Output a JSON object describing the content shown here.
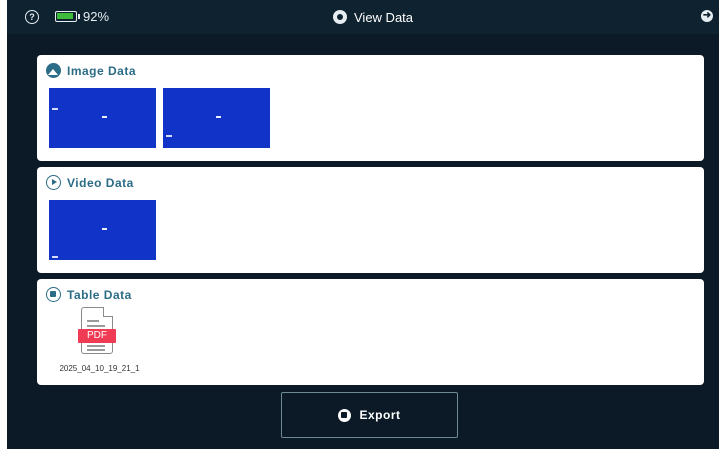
{
  "header": {
    "help_icon": "?",
    "battery_level": 0.92,
    "battery_text": "92%",
    "title": "View Data",
    "exit_icon": "➜"
  },
  "sections": {
    "image": {
      "title": "Image Data",
      "icon": "image-icon",
      "thumbnails": [
        "image-thumbnail-1",
        "image-thumbnail-2"
      ]
    },
    "video": {
      "title": "Video Data",
      "icon": "play-icon",
      "thumbnails": [
        "video-thumbnail-1"
      ]
    },
    "table": {
      "title": "Table Data",
      "icon": "table-icon",
      "file_badge": "PDF",
      "file_name": "2025_04_10_19_21_1"
    }
  },
  "footer": {
    "export_label": "Export",
    "export_icon": "export-icon"
  },
  "colors": {
    "background": "#0b1a26",
    "accent": "#2b6c86",
    "thumbnail": "#1133c8",
    "pdf_badge": "#f03b55",
    "battery": "#3dbb3b"
  }
}
